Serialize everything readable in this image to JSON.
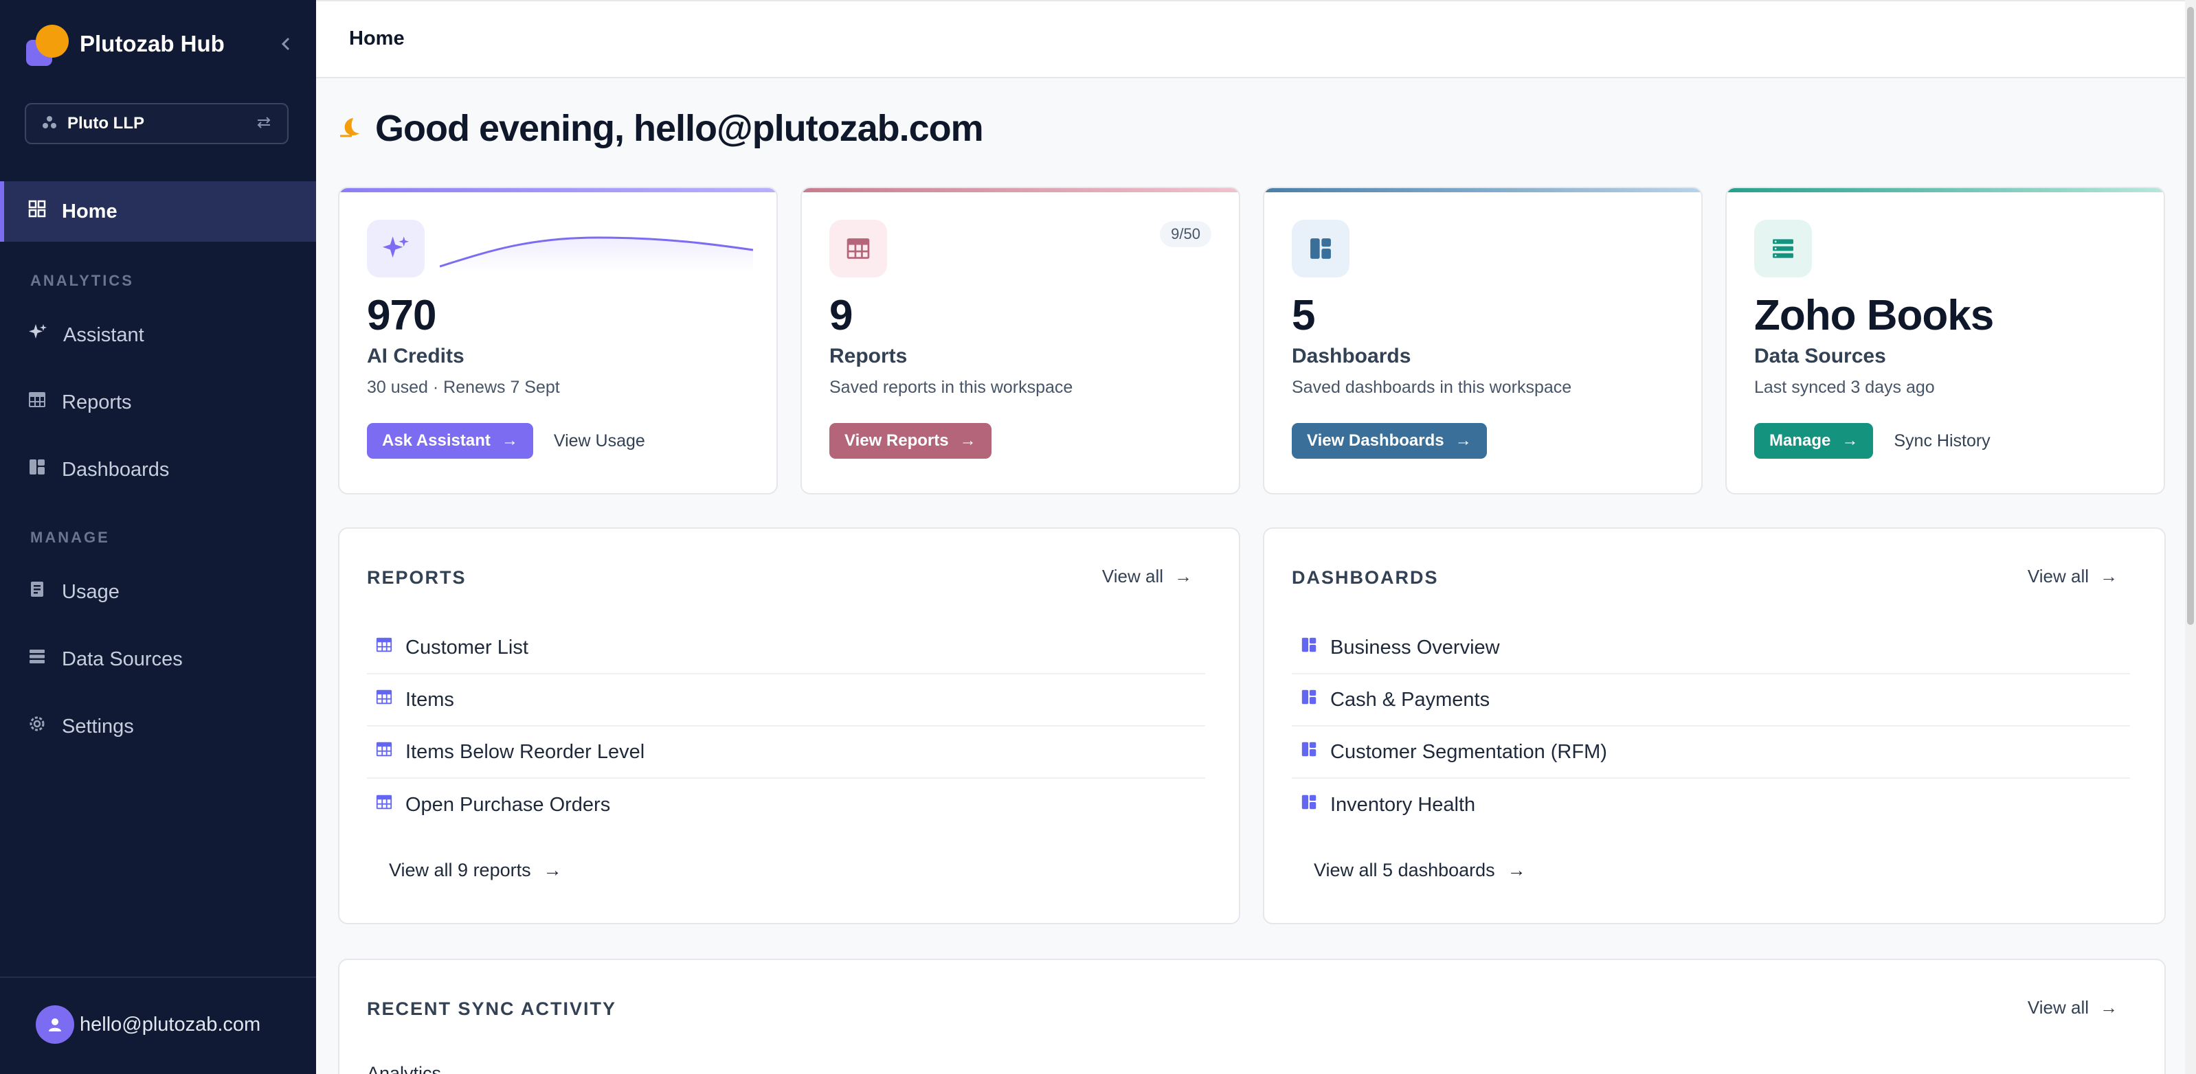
{
  "app": {
    "name": "Plutozab Hub"
  },
  "workspace": {
    "name": "Pluto LLP"
  },
  "nav": {
    "home": "Home",
    "analytics_section": "ANALYTICS",
    "assistant": "Assistant",
    "reports": "Reports",
    "dashboards": "Dashboards",
    "manage_section": "MANAGE",
    "usage": "Usage",
    "data_sources": "Data Sources",
    "settings": "Settings"
  },
  "user": {
    "email": "hello@plutozab.com"
  },
  "topbar": {
    "title": "Home"
  },
  "greeting": {
    "text": "Good evening, hello@plutozab.com",
    "icon": "moon-icon"
  },
  "cards": {
    "credits": {
      "value": "970",
      "label": "AI Credits",
      "sub": "30 used · Renews 7 Sept",
      "primary": "Ask Assistant",
      "secondary": "View Usage",
      "color": "#7c6cf2"
    },
    "reports": {
      "value": "9",
      "label": "Reports",
      "sub": "Saved reports in this workspace",
      "badge": "9/50",
      "primary": "View Reports",
      "color": "#b5657a"
    },
    "dashboards": {
      "value": "5",
      "label": "Dashboards",
      "sub": "Saved dashboards in this workspace",
      "primary": "View Dashboards",
      "color": "#3a6f9a"
    },
    "sources": {
      "value": "Zoho Books",
      "label": "Data Sources",
      "sub": "Last synced 3 days ago",
      "primary": "Manage",
      "secondary": "Sync History",
      "color": "#14937f"
    }
  },
  "reports_panel": {
    "title": "REPORTS",
    "view_all": "View all",
    "items": [
      "Customer List",
      "Items",
      "Items Below Reorder Level",
      "Open Purchase Orders"
    ],
    "footer": "View all 9 reports"
  },
  "dashboards_panel": {
    "title": "DASHBOARDS",
    "view_all": "View all",
    "items": [
      "Business Overview",
      "Cash & Payments",
      "Customer Segmentation (RFM)",
      "Inventory Health"
    ],
    "footer": "View all 5 dashboards"
  },
  "sync_panel": {
    "title": "RECENT SYNC ACTIVITY",
    "view_all": "View all",
    "peek": "Analytics"
  }
}
